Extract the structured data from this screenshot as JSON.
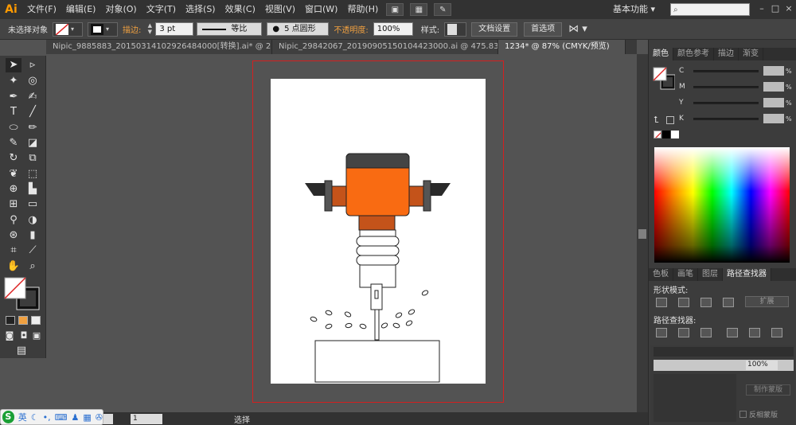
{
  "menubar": {
    "logo": "Ai",
    "items": [
      "文件(F)",
      "编辑(E)",
      "对象(O)",
      "文字(T)",
      "选择(S)",
      "效果(C)",
      "视图(V)",
      "窗口(W)",
      "帮助(H)"
    ],
    "workspace": "基本功能"
  },
  "controlbar": {
    "selection_label": "未选择对象",
    "stroke_label": "描边:",
    "stroke_weight": "3 pt",
    "stroke_profile": "等比",
    "brush": "5 点圆形",
    "opacity_label": "不透明度:",
    "opacity_value": "100%",
    "style_label": "样式:",
    "doc_setup_button": "文档设置",
    "prefs_button": "首选项"
  },
  "doctabs": [
    "Nipic_9885883_20150314102926484000[转换].ai* @ 2...",
    "Nipic_29842067_20190905150104423000.ai @ 475.83%...",
    "1234* @ 87% (CMYK/预览)"
  ],
  "color_panel": {
    "tabs": [
      "颜色",
      "颜色参考",
      "描边",
      "渐变"
    ],
    "channels": [
      "C",
      "M",
      "Y",
      "K"
    ],
    "pct": "%"
  },
  "pathfinder_panel": {
    "tabs": [
      "色板",
      "画笔",
      "图层",
      "路径查找器"
    ],
    "shape_modes_label": "形状模式:",
    "expand_button": "扩展",
    "pathfinders_label": "路径查找器:"
  },
  "transparency_panel": {
    "opacity_value": "100%",
    "release_mask_button": "制作蒙版",
    "invert_mask_label": "反相蒙版"
  },
  "statusbar": {
    "page": "1",
    "status_text": "选择"
  },
  "ime": {
    "logo": "S",
    "lang": "英"
  },
  "colors": {
    "drill_orange": "#f96b12",
    "drill_dark_orange": "#c4531a",
    "drill_gray": "#555555",
    "drill_black": "#2a2a2a"
  }
}
